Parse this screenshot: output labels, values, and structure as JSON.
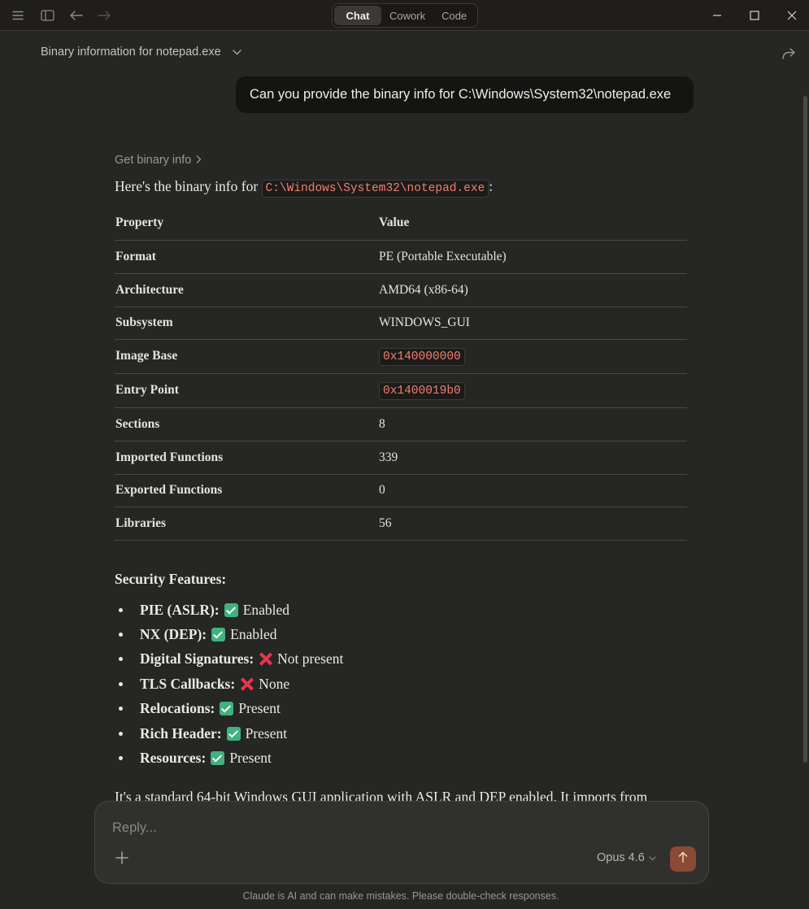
{
  "titlebar": {
    "tabs": [
      {
        "label": "Chat",
        "active": true
      },
      {
        "label": "Cowork",
        "active": false
      },
      {
        "label": "Code",
        "active": false
      }
    ],
    "icons": [
      "menu-icon",
      "sidebar-toggle-icon",
      "back-arrow-icon",
      "forward-arrow-icon"
    ],
    "window_controls": [
      "minimize-icon",
      "maximize-icon",
      "close-icon"
    ]
  },
  "header": {
    "conversation_title": "Binary information for notepad.exe",
    "share_icon": "share-icon"
  },
  "user_message": {
    "text": "Can you provide the binary info for C:\\Windows\\System32\\notepad.exe"
  },
  "assistant": {
    "tool_label": "Get binary info",
    "intro_prefix": "Here's the binary info for",
    "intro_path": "C:\\Windows\\System32\\notepad.exe",
    "intro_suffix": ":",
    "table": {
      "headers": [
        "Property",
        "Value"
      ],
      "rows": [
        {
          "property": "Format",
          "value": "PE (Portable Executable)",
          "code": false
        },
        {
          "property": "Architecture",
          "value": "AMD64 (x86-64)",
          "code": false
        },
        {
          "property": "Subsystem",
          "value": "WINDOWS_GUI",
          "code": false
        },
        {
          "property": "Image Base",
          "value": "0x140000000",
          "code": true
        },
        {
          "property": "Entry Point",
          "value": "0x1400019b0",
          "code": true
        },
        {
          "property": "Sections",
          "value": "8",
          "code": false
        },
        {
          "property": "Imported Functions",
          "value": "339",
          "code": false
        },
        {
          "property": "Exported Functions",
          "value": "0",
          "code": false
        },
        {
          "property": "Libraries",
          "value": "56",
          "code": false
        }
      ]
    },
    "security_title": "Security Features:",
    "security_features": [
      {
        "name": "PIE (ASLR):",
        "status_icon": "check-icon",
        "status": "Enabled"
      },
      {
        "name": "NX (DEP):",
        "status_icon": "check-icon",
        "status": "Enabled"
      },
      {
        "name": "Digital Signatures:",
        "status_icon": "cross-icon",
        "status": "Not present"
      },
      {
        "name": "TLS Callbacks:",
        "status_icon": "cross-icon",
        "status": "None"
      },
      {
        "name": "Relocations:",
        "status_icon": "check-icon",
        "status": "Present"
      },
      {
        "name": "Rich Header:",
        "status_icon": "check-icon",
        "status": "Present"
      },
      {
        "name": "Resources:",
        "status_icon": "check-icon",
        "status": "Present"
      }
    ],
    "trailing_text": "It's a standard 64-bit Windows GUI application with ASLR and DEP enabled. It imports from"
  },
  "composer": {
    "placeholder": "Reply...",
    "model": "Opus 4.6",
    "send_icon": "arrow-up-icon",
    "add_icon": "plus-icon"
  },
  "footer": {
    "disclaimer": "Claude is AI and can make mistakes. Please double-check responses."
  },
  "colors": {
    "background": "#262624",
    "titlebar": "#1f1e1d",
    "user_bubble": "#141413",
    "code_text": "#f27f6e",
    "send_button": "#8a4a36",
    "check": "#3fb27f",
    "cross": "#e8344f"
  }
}
